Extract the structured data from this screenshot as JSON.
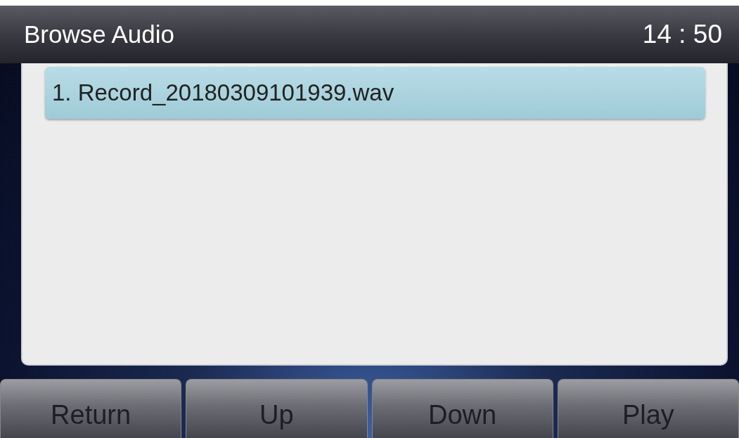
{
  "header": {
    "title": "Browse Audio",
    "time": "14 : 50"
  },
  "files": [
    {
      "label": "1. Record_20180309101939.wav",
      "selected": true
    }
  ],
  "softkeys": [
    "Return",
    "Up",
    "Down",
    "Play"
  ]
}
